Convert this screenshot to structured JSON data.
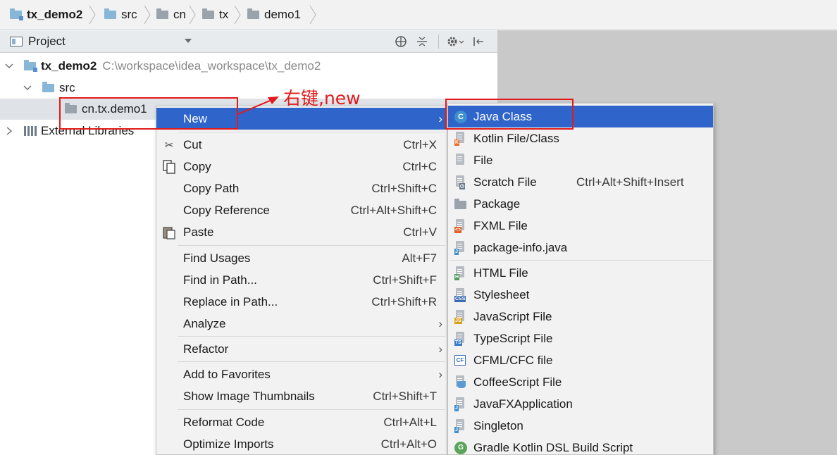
{
  "breadcrumb": {
    "items": [
      "tx_demo2",
      "src",
      "cn",
      "tx",
      "demo1"
    ]
  },
  "project_panel": {
    "title": "Project",
    "header_icons": [
      "globe-icon",
      "collapse-icon",
      "gear-icon",
      "hide-icon"
    ],
    "tree": {
      "root_name": "tx_demo2",
      "root_path": "C:\\workspace\\idea_workspace\\tx_demo2",
      "src": "src",
      "package": "cn.tx.demo1",
      "external": "External Libraries"
    }
  },
  "context_menu": {
    "items": [
      {
        "label": "New",
        "shortcut": "",
        "submenu": true,
        "selected": true
      },
      {
        "label": "Cut",
        "shortcut": "Ctrl+X",
        "icon": "scissors-icon"
      },
      {
        "label": "Copy",
        "shortcut": "Ctrl+C",
        "icon": "copy-icon"
      },
      {
        "label": "Copy Path",
        "shortcut": "Ctrl+Shift+C"
      },
      {
        "label": "Copy Reference",
        "shortcut": "Ctrl+Alt+Shift+C"
      },
      {
        "label": "Paste",
        "shortcut": "Ctrl+V",
        "icon": "paste-icon"
      },
      {
        "label": "Find Usages",
        "shortcut": "Alt+F7"
      },
      {
        "label": "Find in Path...",
        "shortcut": "Ctrl+Shift+F"
      },
      {
        "label": "Replace in Path...",
        "shortcut": "Ctrl+Shift+R"
      },
      {
        "label": "Analyze",
        "shortcut": "",
        "submenu": true
      },
      {
        "label": "Refactor",
        "shortcut": "",
        "submenu": true
      },
      {
        "label": "Add to Favorites",
        "shortcut": "",
        "submenu": true
      },
      {
        "label": "Show Image Thumbnails",
        "shortcut": "Ctrl+Shift+T"
      },
      {
        "label": "Reformat Code",
        "shortcut": "Ctrl+Alt+L"
      },
      {
        "label": "Optimize Imports",
        "shortcut": "Ctrl+Alt+O"
      }
    ]
  },
  "new_submenu": {
    "items": [
      {
        "label": "Java Class",
        "shortcut": "",
        "selected": true
      },
      {
        "label": "Kotlin File/Class",
        "shortcut": ""
      },
      {
        "label": "File",
        "shortcut": ""
      },
      {
        "label": "Scratch File",
        "shortcut": "Ctrl+Alt+Shift+Insert"
      },
      {
        "label": "Package",
        "shortcut": ""
      },
      {
        "label": "FXML File",
        "shortcut": ""
      },
      {
        "label": "package-info.java",
        "shortcut": ""
      },
      {
        "label": "HTML File",
        "shortcut": ""
      },
      {
        "label": "Stylesheet",
        "shortcut": ""
      },
      {
        "label": "JavaScript File",
        "shortcut": ""
      },
      {
        "label": "TypeScript File",
        "shortcut": ""
      },
      {
        "label": "CFML/CFC file",
        "shortcut": ""
      },
      {
        "label": "CoffeeScript File",
        "shortcut": ""
      },
      {
        "label": "JavaFXApplication",
        "shortcut": ""
      },
      {
        "label": "Singleton",
        "shortcut": ""
      },
      {
        "label": "Gradle Kotlin DSL Build Script",
        "shortcut": ""
      }
    ],
    "icon_tags": [
      "",
      "K",
      "",
      "",
      "",
      "<>",
      "J",
      "H",
      "CSS",
      "JS",
      "TS",
      "CF",
      "",
      "J",
      "J",
      ""
    ]
  },
  "annotation": {
    "text": "右键,new"
  },
  "colors": {
    "selection": "#2f65ca",
    "annotation": "#e21a1a",
    "menu_bg": "#f2f2f2"
  }
}
